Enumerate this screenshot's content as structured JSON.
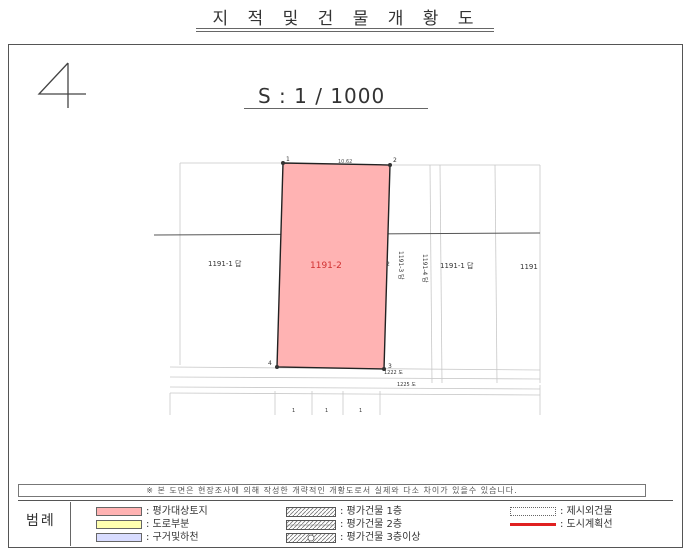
{
  "header": {
    "title": "지 적 및 건 물 개 황 도"
  },
  "sheet": {
    "number": "4",
    "scale": "S : 1 / 1000"
  },
  "map": {
    "subject_parcel": "1191-2",
    "vertex_labels": [
      "1",
      "2",
      "3",
      "4"
    ],
    "dimension_top": "10.62",
    "neighbors": {
      "left": "1191-1 답",
      "right_vertical_1": "1191-3 답",
      "right_vertical_2": "1191-4 답",
      "right": "1191-1 답",
      "far_right": "1191",
      "bottom_1": "1222 도",
      "bottom_2": "1225 도"
    },
    "bottom_lot_marks": [
      "1",
      "1",
      "1"
    ]
  },
  "notice": "※ 본 도면은 현장조사에 의해 작성한 개략적인 개황도로서 실제와 다소 차이가 있을수 있습니다.",
  "legend": {
    "title": "범례",
    "items": [
      {
        "label": ": 평가대상토지",
        "color": "#ffb3b3"
      },
      {
        "label": ": 도로부분",
        "color": "#ffffb0"
      },
      {
        "label": ": 구거및하천",
        "color": "#d8dcff"
      },
      {
        "label": ": 평가건물 1층"
      },
      {
        "label": ": 평가건물 2층"
      },
      {
        "label": ": 평가건물 3층이상"
      },
      {
        "label": ": 제시외건물"
      },
      {
        "label": ": 도시계획선",
        "color": "#e02020"
      }
    ]
  },
  "colors": {
    "subject_fill": "#ffb3b3",
    "subject_border": "#222222",
    "plan_line": "#e02020"
  }
}
